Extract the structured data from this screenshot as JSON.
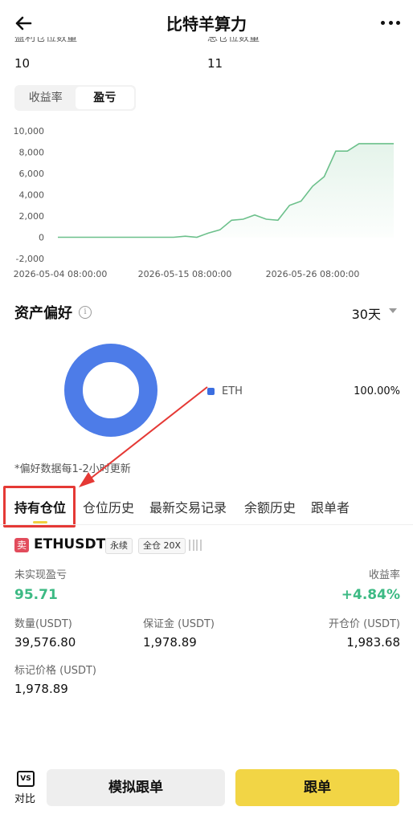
{
  "header": {
    "title": "比特羊算力",
    "back_icon": "arrow-left-icon",
    "more_icon": "more-dots-icon"
  },
  "stats": {
    "profit_count_label": "盈利仓位数量",
    "profit_count": "10",
    "total_count_label": "总仓位数量",
    "total_count": "11"
  },
  "segment": {
    "tab_rate": "收益率",
    "tab_pnl": "盈亏"
  },
  "chart_data": {
    "type": "area",
    "yticks": [
      "10,000",
      "8,000",
      "6,000",
      "4,000",
      "2,000",
      "0",
      "-2,000"
    ],
    "ylim": [
      -2000,
      10000
    ],
    "xlabels": [
      "2026-05-04 08:00:00",
      "2026-05-15 08:00:00",
      "2026-05-26 08:00:00"
    ],
    "x": [
      "2026-05-04",
      "2026-05-05",
      "2026-05-06",
      "2026-05-07",
      "2026-05-08",
      "2026-05-09",
      "2026-05-10",
      "2026-05-11",
      "2026-05-12",
      "2026-05-13",
      "2026-05-14",
      "2026-05-15",
      "2026-05-16",
      "2026-05-17",
      "2026-05-18",
      "2026-05-19",
      "2026-05-20",
      "2026-05-21",
      "2026-05-22",
      "2026-05-23",
      "2026-05-24",
      "2026-05-25",
      "2026-05-26",
      "2026-05-27",
      "2026-05-28",
      "2026-05-29",
      "2026-05-30",
      "2026-05-31",
      "2026-06-01",
      "2026-06-02"
    ],
    "values": [
      0,
      0,
      0,
      0,
      0,
      0,
      0,
      0,
      0,
      0,
      0,
      100,
      0,
      400,
      700,
      1600,
      1700,
      2100,
      1700,
      1600,
      3000,
      3400,
      4800,
      5700,
      8100,
      8100,
      8800,
      8800,
      8800,
      8800
    ],
    "color": "#6cc08b",
    "grid": false
  },
  "asset_pref": {
    "title": "资产偏好",
    "info_icon": "info-icon",
    "period": "30天",
    "legend_label": "ETH",
    "legend_value": "100.00%",
    "donut_color": "#4d7ce8",
    "note": "*偏好数据每1-2小时更新"
  },
  "tabs": [
    "持有仓位",
    "仓位历史",
    "最新交易记录",
    "余额历史",
    "跟单者"
  ],
  "position": {
    "side_badge": "卖",
    "symbol": "ETHUSDT",
    "type_pill": "永续",
    "margin_pill": "全仓 20X",
    "unrealized_label": "未实现盈亏",
    "unrealized_value": "95.71",
    "roi_label": "收益率",
    "roi_value": "+4.84%",
    "qty_label": "数量(USDT)",
    "qty_value": "39,576.80",
    "margin_label": "保证金 (USDT)",
    "margin_value": "1,978.89",
    "entry_label": "开仓价 (USDT)",
    "entry_value": "1,983.68",
    "mark_label": "标记价格 (USDT)",
    "mark_value": "1,978.89"
  },
  "bottom_bar": {
    "vs_icon_text": "VS",
    "vs_label": "对比",
    "sim_button": "模拟跟单",
    "follow_button": "跟单",
    "follow_color": "#f2d545"
  }
}
